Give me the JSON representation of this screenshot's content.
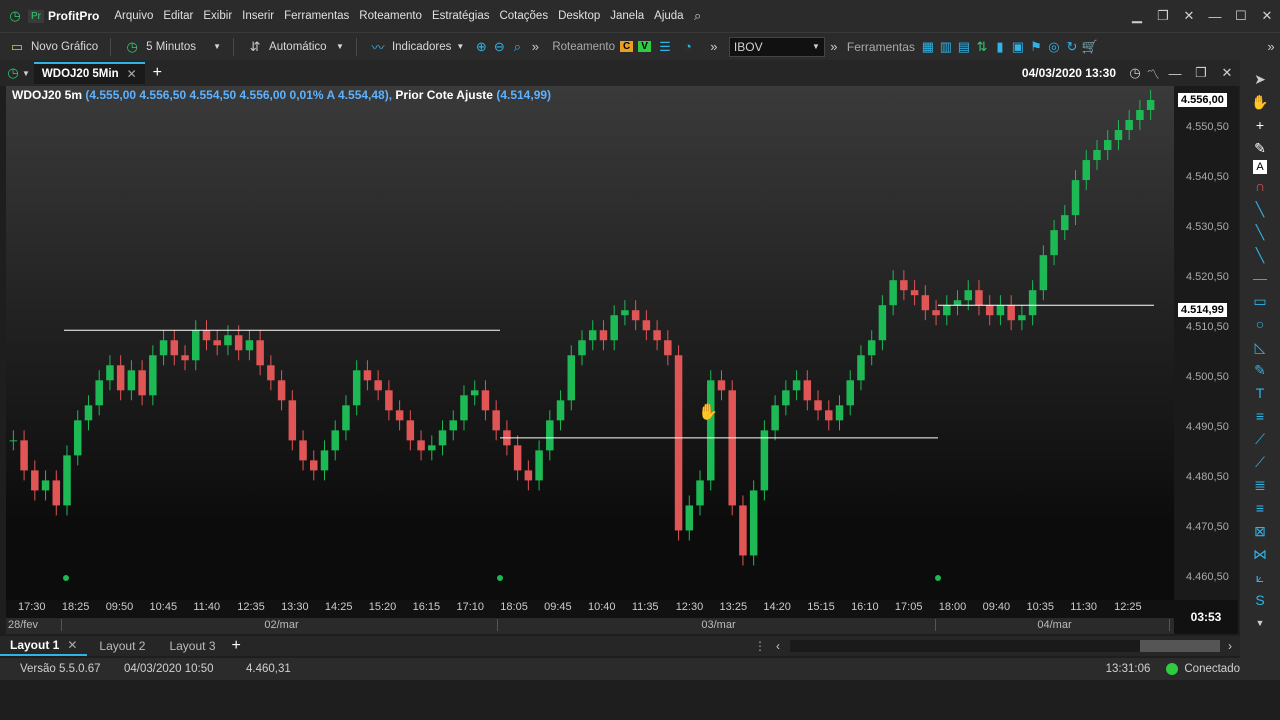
{
  "app": {
    "name": "ProfitPro",
    "logo_text": "Pr"
  },
  "menu": [
    "Arquivo",
    "Editar",
    "Exibir",
    "Inserir",
    "Ferramentas",
    "Roteamento",
    "Estratégias",
    "Cotações",
    "Desktop",
    "Janela",
    "Ajuda"
  ],
  "toolbar": {
    "new_chart": "Novo Gráfico",
    "interval": "5 Minutos",
    "mode": "Automático",
    "indicators": "Indicadores",
    "routing": "Roteamento",
    "routing_c": "C",
    "routing_v": "V",
    "symbol": "IBOV",
    "tools": "Ferramentas"
  },
  "chart_tab": {
    "title": "WDOJ20 5Min",
    "datetime": "04/03/2020 13:30"
  },
  "quote": {
    "symbol_label": "WDOJ20 5m",
    "values": "(4.555,00  4.556,50  4.554,50  4.556,00  0,01%  A 4.554,48),",
    "prior_label": "Prior Cote Ajuste",
    "prior_value": "(4.514,99)"
  },
  "chart_data": {
    "type": "candlestick",
    "y_ticks": [
      "4.550,50",
      "4.540,50",
      "4.530,50",
      "4.520,50",
      "4.510,50",
      "4.500,50",
      "4.490,50",
      "4.480,50",
      "4.470,50",
      "4.460,50"
    ],
    "ylim": [
      4460.5,
      4556.0
    ],
    "current_price": "4.556,00",
    "prior_adjust_price": "4.514,99",
    "x_ticks": [
      "17:30",
      "18:25",
      "09:50",
      "10:45",
      "11:40",
      "12:35",
      "13:30",
      "14:25",
      "15:20",
      "16:15",
      "17:10",
      "18:05",
      "09:45",
      "10:40",
      "11:35",
      "12:30",
      "13:25",
      "14:20",
      "15:15",
      "16:10",
      "17:05",
      "18:00",
      "09:40",
      "10:35",
      "11:30",
      "12:25"
    ],
    "date_labels": [
      "28/fev",
      "02/mar",
      "03/mar",
      "04/mar"
    ],
    "countdown": "03:53",
    "closes": [
      4488,
      4482,
      4478,
      4480,
      4475,
      4485,
      4492,
      4495,
      4500,
      4503,
      4498,
      4502,
      4497,
      4505,
      4508,
      4505,
      4504,
      4510,
      4508,
      4507,
      4509,
      4506,
      4508,
      4503,
      4500,
      4496,
      4488,
      4484,
      4482,
      4486,
      4490,
      4495,
      4502,
      4500,
      4498,
      4494,
      4492,
      4488,
      4486,
      4487,
      4490,
      4492,
      4497,
      4498,
      4494,
      4490,
      4487,
      4482,
      4480,
      4486,
      4492,
      4496,
      4505,
      4508,
      4510,
      4508,
      4513,
      4514,
      4512,
      4510,
      4508,
      4505,
      4470,
      4475,
      4480,
      4500,
      4498,
      4475,
      4465,
      4478,
      4490,
      4495,
      4498,
      4500,
      4496,
      4494,
      4492,
      4495,
      4500,
      4505,
      4508,
      4515,
      4520,
      4518,
      4517,
      4514,
      4513,
      4515,
      4516,
      4518,
      4515,
      4513,
      4515,
      4512,
      4513,
      4518,
      4525,
      4530,
      4533,
      4540,
      4544,
      4546,
      4548,
      4550,
      4552,
      4554,
      4556
    ]
  },
  "price_lines": [
    "4.514,99"
  ],
  "layouts": [
    "Layout 1",
    "Layout 2",
    "Layout 3"
  ],
  "status": {
    "version": "Versão 5.5.0.67",
    "datetime": "04/03/2020 10:50",
    "price": "4.460,31",
    "clock": "13:31:06",
    "connection": "Conectado"
  },
  "colors": {
    "up": "#1db954",
    "down": "#e05555",
    "accent": "#2fb4e8",
    "connected": "#2ecc40"
  }
}
